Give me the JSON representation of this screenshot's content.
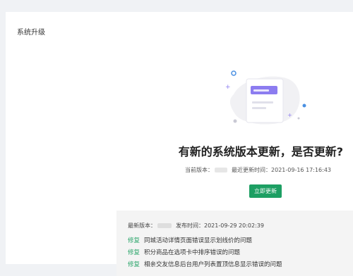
{
  "page": {
    "title": "系统升级"
  },
  "main": {
    "headline": "有新的系统版本更新，是否更新?",
    "current_version_label": "当前版本：",
    "last_update_label": "最近更新时间：",
    "last_update_time": "2021-09-16 17:16:43",
    "update_button": "立即更新"
  },
  "changelog": {
    "latest_version_label": "最新版本：",
    "release_time_label": "发布时间：",
    "release_time": "2021-09-29 20:02:39",
    "tag_label": "修复",
    "items": [
      "同城活动详情页面错误显示划线价的问题",
      "积分商品在选项卡中排序错误的问题",
      "相亲交友信息后台用户列表置顶信息显示错误的问题"
    ]
  },
  "colors": {
    "accent": "#1d9f63",
    "tag": "#2aa56a",
    "illustration": "#8c7cf0"
  }
}
